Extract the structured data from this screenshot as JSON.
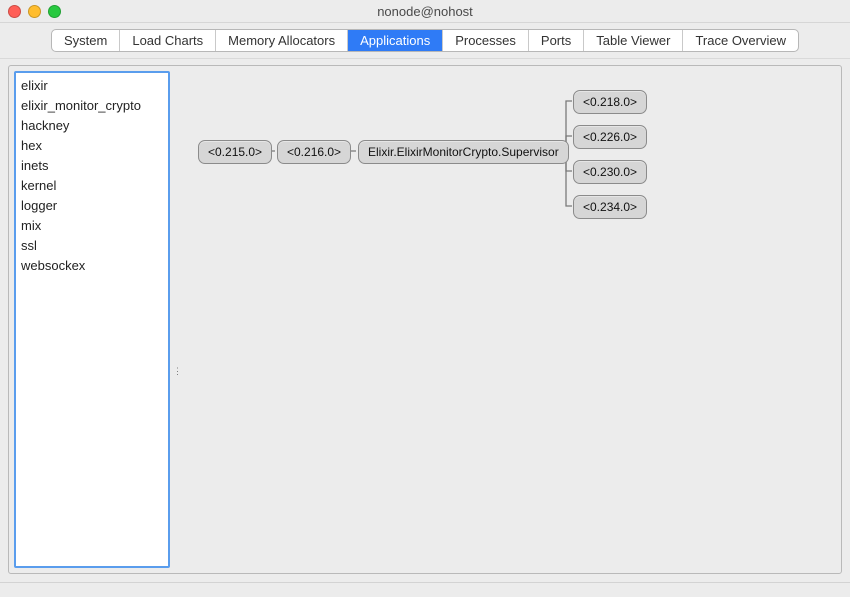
{
  "window": {
    "title": "nonode@nohost"
  },
  "tabs": [
    {
      "label": "System",
      "active": false
    },
    {
      "label": "Load Charts",
      "active": false
    },
    {
      "label": "Memory Allocators",
      "active": false
    },
    {
      "label": "Applications",
      "active": true
    },
    {
      "label": "Processes",
      "active": false
    },
    {
      "label": "Ports",
      "active": false
    },
    {
      "label": "Table Viewer",
      "active": false
    },
    {
      "label": "Trace Overview",
      "active": false
    }
  ],
  "applications": [
    "elixir",
    "elixir_monitor_crypto",
    "hackney",
    "hex",
    "inets",
    "kernel",
    "logger",
    "mix",
    "ssl",
    "websockex"
  ],
  "tree": {
    "n0": "<0.215.0>",
    "n1": "<0.216.0>",
    "n2": "Elixir.ElixirMonitorCrypto.Supervisor",
    "c0": "<0.218.0>",
    "c1": "<0.226.0>",
    "c2": "<0.230.0>",
    "c3": "<0.234.0>"
  }
}
